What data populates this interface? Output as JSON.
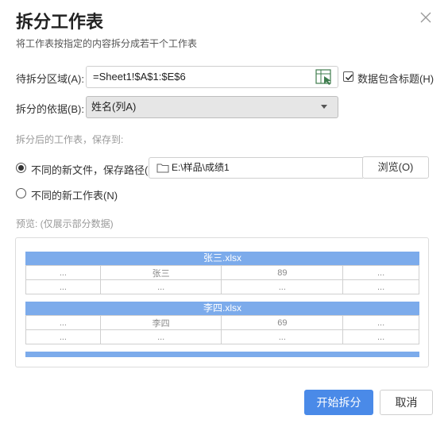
{
  "dialog": {
    "title": "拆分工作表",
    "subtitle": "将工作表按指定的内容拆分成若干个工作表"
  },
  "range": {
    "label": "待拆分区域(A):",
    "value": "=Sheet1!$A$1:$E$6",
    "checkbox_label": "数据包含标题(H)",
    "checkbox_checked": true
  },
  "basis": {
    "label": "拆分的依据(B):",
    "selected": "姓名(列A)"
  },
  "save": {
    "hint": "拆分后的工作表，保存到:",
    "option_file_label": "不同的新文件，保存路径(P)",
    "path_value": "E:\\样品\\成绩1",
    "browse_label": "浏览(O)",
    "option_sheet_label": "不同的新工作表(N)"
  },
  "preview": {
    "hint": "预览:   (仅展示部分数据)",
    "files": [
      {
        "name": "张三.xlsx",
        "rows": [
          [
            "...",
            "张三",
            "89",
            "..."
          ],
          [
            "...",
            "...",
            "...",
            "..."
          ]
        ]
      },
      {
        "name": "李四.xlsx",
        "rows": [
          [
            "...",
            "李四",
            "69",
            "..."
          ],
          [
            "...",
            "...",
            "...",
            "..."
          ]
        ]
      }
    ]
  },
  "buttons": {
    "start": "开始拆分",
    "cancel": "取消"
  },
  "colors": {
    "accent": "#4a8ae8",
    "preview_header": "#7cabeb"
  }
}
